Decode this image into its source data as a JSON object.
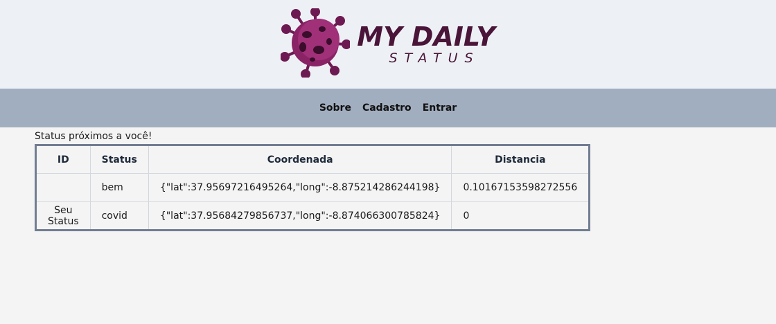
{
  "logo": {
    "main": "MY DAILY",
    "sub": "STATUS",
    "colors": {
      "dark": "#4a1538",
      "virus": "#7d1f5c"
    }
  },
  "nav": {
    "items": [
      "Sobre",
      "Cadastro",
      "Entrar"
    ]
  },
  "main": {
    "heading": "Status próximos a você!",
    "table": {
      "headers": [
        "ID",
        "Status",
        "Coordenada",
        "Distancia"
      ],
      "rows": [
        {
          "id": "",
          "status": "bem",
          "coord": "{\"lat\":37.95697216495264,\"long\":-8.875214286244198}",
          "dist": "0.10167153598272556"
        },
        {
          "id": "Seu Status",
          "status": "covid",
          "coord": "{\"lat\":37.95684279856737,\"long\":-8.874066300785824}",
          "dist": "0"
        }
      ]
    }
  }
}
